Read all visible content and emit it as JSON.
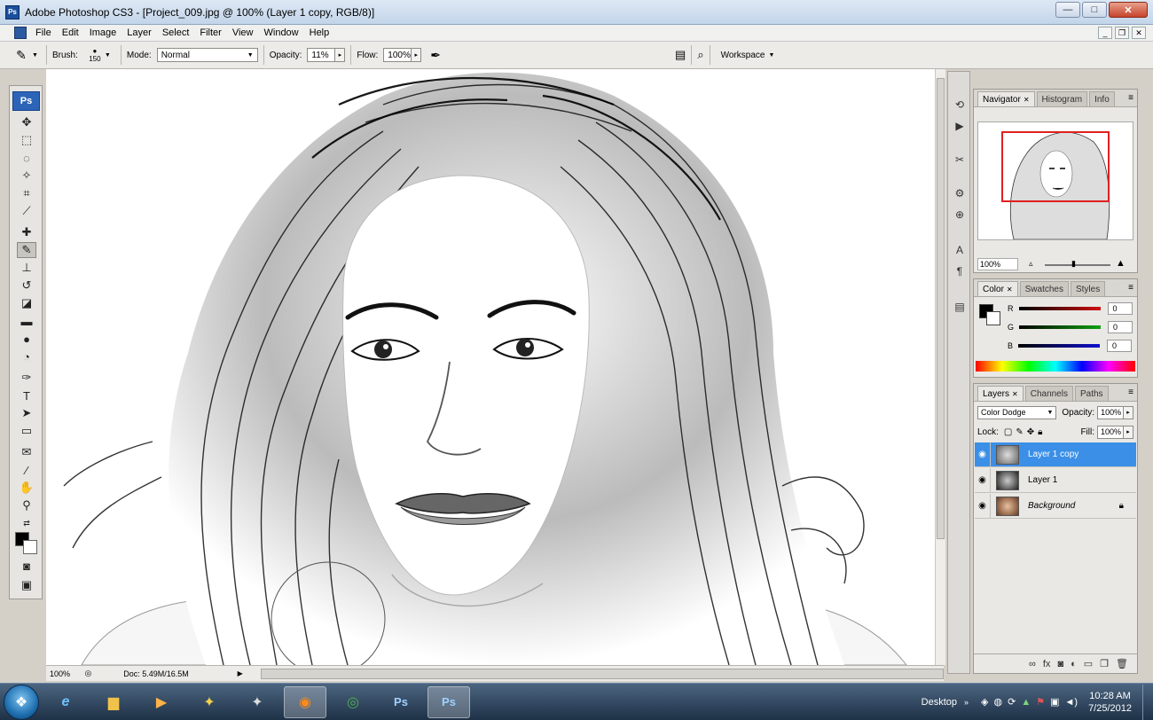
{
  "window": {
    "title": "Adobe Photoshop CS3 - [Project_009.jpg @ 100% (Layer 1 copy, RGB/8)]",
    "app_badge": "Ps",
    "minimize": "—",
    "maximize": "□",
    "close": "✕"
  },
  "menu": [
    "File",
    "Edit",
    "Image",
    "Layer",
    "Select",
    "Filter",
    "View",
    "Window",
    "Help"
  ],
  "options": {
    "brush_label": "Brush:",
    "brush_size": "150",
    "mode_label": "Mode:",
    "mode_value": "Normal",
    "opacity_label": "Opacity:",
    "opacity_value": "11%",
    "flow_label": "Flow:",
    "flow_value": "100%",
    "workspace_label": "Workspace"
  },
  "tools": {
    "badge": "Ps",
    "type_glyph": "T"
  },
  "status": {
    "zoom": "100%",
    "doc_info": "Doc: 5.49M/16.5M"
  },
  "navigator": {
    "tabs": [
      "Navigator",
      "Histogram",
      "Info"
    ],
    "zoom": "100%"
  },
  "color_panel": {
    "tabs": [
      "Color",
      "Swatches",
      "Styles"
    ],
    "channels": [
      {
        "label": "R",
        "value": "0",
        "color": "#d01010"
      },
      {
        "label": "G",
        "value": "0",
        "color": "#10a010"
      },
      {
        "label": "B",
        "value": "0",
        "color": "#1010d0"
      }
    ]
  },
  "layers_panel": {
    "tabs": [
      "Layers",
      "Channels",
      "Paths"
    ],
    "blend_mode": "Color Dodge",
    "opacity_label": "Opacity:",
    "opacity_value": "100%",
    "lock_label": "Lock:",
    "fill_label": "Fill:",
    "fill_value": "100%",
    "layers": [
      {
        "name": "Layer 1 copy",
        "selected": true,
        "locked": false
      },
      {
        "name": "Layer 1",
        "selected": false,
        "locked": false
      },
      {
        "name": "Background",
        "selected": false,
        "locked": true
      }
    ]
  },
  "taskbar": {
    "desktop_label": "Desktop",
    "time": "10:28 AM",
    "date": "7/25/2012"
  },
  "colors": {
    "selection": "#3b8fe6",
    "navigator_frame": "#e02020",
    "foreground": "#000000",
    "background": "#ffffff"
  }
}
